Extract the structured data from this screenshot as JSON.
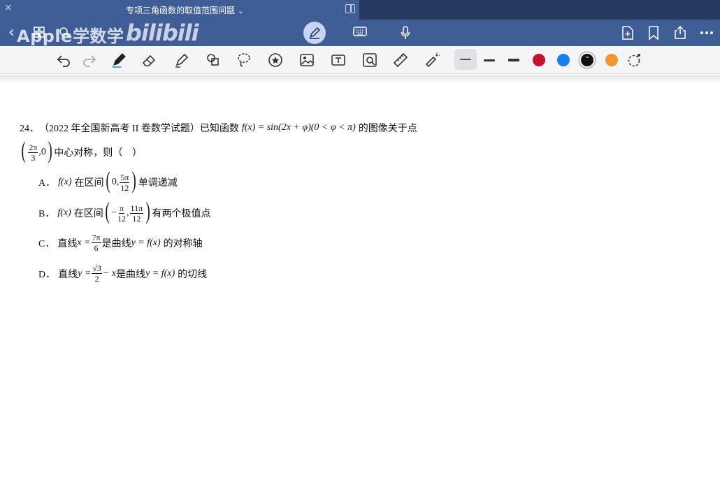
{
  "window": {
    "title": "专项三角函数的取值范围问题",
    "title_chevron": "⌄",
    "close_symbol": "×"
  },
  "navbar": {
    "back_symbol": "‹",
    "watermark_text": "Apple学数学",
    "watermark_logo": "bilibili"
  },
  "toolbar": {
    "tools": [
      "undo-icon",
      "redo-icon",
      "pen-icon",
      "eraser-icon",
      "highlighter-icon",
      "shapes-icon",
      "lasso-icon",
      "sticker-icon",
      "image-icon",
      "textbox-icon",
      "scan-icon",
      "ruler-icon",
      "laser-pointer-icon"
    ],
    "colors": [
      "#c8102e",
      "#1a7ff0",
      "#111111",
      "#f0962a"
    ],
    "selected_color": "#111111"
  },
  "question": {
    "number": "24．",
    "source": "（2022 年全国新高考 II 卷数学试题）已知函数",
    "func": "f(x) = sin(2x + φ)(0 < φ < π)",
    "stem_tail": "的图像关于点",
    "point_num": "2π",
    "point_den": "3",
    "point_y": ",0",
    "stem_line2": "中心对称，则（　）",
    "options": {
      "A": {
        "label": "A．",
        "func": "f(x)",
        "text1": "在区间",
        "left": "0,",
        "frac_num": "5π",
        "frac_den": "12",
        "text2": "单调递减"
      },
      "B": {
        "label": "B．",
        "func": "f(x)",
        "text1": "在区间",
        "left_sign": "−",
        "frac1_num": "π",
        "frac1_den": "12",
        "comma": ",",
        "frac2_num": "11π",
        "frac2_den": "12",
        "text2": "有两个极值点"
      },
      "C": {
        "label": "C．",
        "text1": "直线",
        "eq": "x =",
        "frac_num": "7π",
        "frac_den": "6",
        "text2": "是曲线",
        "curve": "y = f(x)",
        "text3": "的对称轴"
      },
      "D": {
        "label": "D．",
        "text1": "直线",
        "eq": "y =",
        "frac_num": "√3",
        "frac_den": "2",
        "minus_x": "− x",
        "text2": "是曲线",
        "curve": "y = f(x)",
        "text3": "的切线"
      }
    }
  }
}
